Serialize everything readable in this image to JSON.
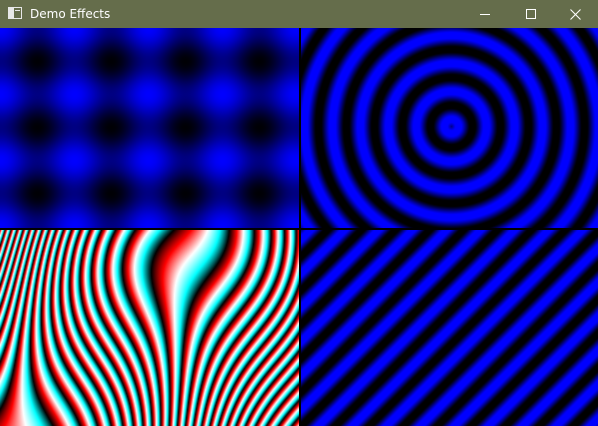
{
  "window": {
    "title": "Demo Effects",
    "icon": "app-window-icon",
    "controls": {
      "minimize_icon": "minimize-icon",
      "maximize_icon": "maximize-icon",
      "close_icon": "close-icon"
    },
    "titlebar_color": "#656d4b"
  },
  "effects": [
    {
      "name": "plasma-grid",
      "colors": [
        "#000000",
        "#0000ff"
      ]
    },
    {
      "name": "concentric-rings",
      "colors": [
        "#000000",
        "#0000ff"
      ]
    },
    {
      "name": "color-bands",
      "colors": [
        "#ff0000",
        "#ffffff",
        "#00ffff",
        "#000000"
      ]
    },
    {
      "name": "diagonal-stripes",
      "colors": [
        "#000000",
        "#0000ff"
      ]
    }
  ]
}
